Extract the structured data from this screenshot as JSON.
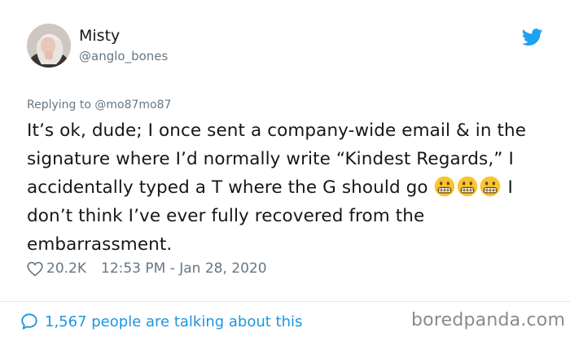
{
  "user": {
    "display_name": "Misty",
    "handle": "@anglo_bones"
  },
  "icons": {
    "platform": "twitter-bird-icon",
    "like": "heart-icon",
    "reply": "speech-bubble-icon",
    "emoji": "grimacing-face-emoji"
  },
  "tweet": {
    "replying_to": "Replying to @mo87mo87",
    "text_part1": "It’s ok, dude; I once sent a company-wide email & in the signature where I’d normally write “Kindest Regards,” I accidentally typed a T where the G should go ",
    "text_part2": " I don’t think I’ve ever fully recovered from the embarrassment.",
    "like_count": "20.2K",
    "timestamp": "12:53 PM - Jan 28, 2020"
  },
  "footer": {
    "talking_text": "1,567 people are talking about this",
    "watermark": "boredpanda.com"
  },
  "colors": {
    "accent": "#1da1f2",
    "link": "#1b95e0",
    "muted": "#657786",
    "text": "#14171a",
    "divider": "#e1e8ed"
  }
}
